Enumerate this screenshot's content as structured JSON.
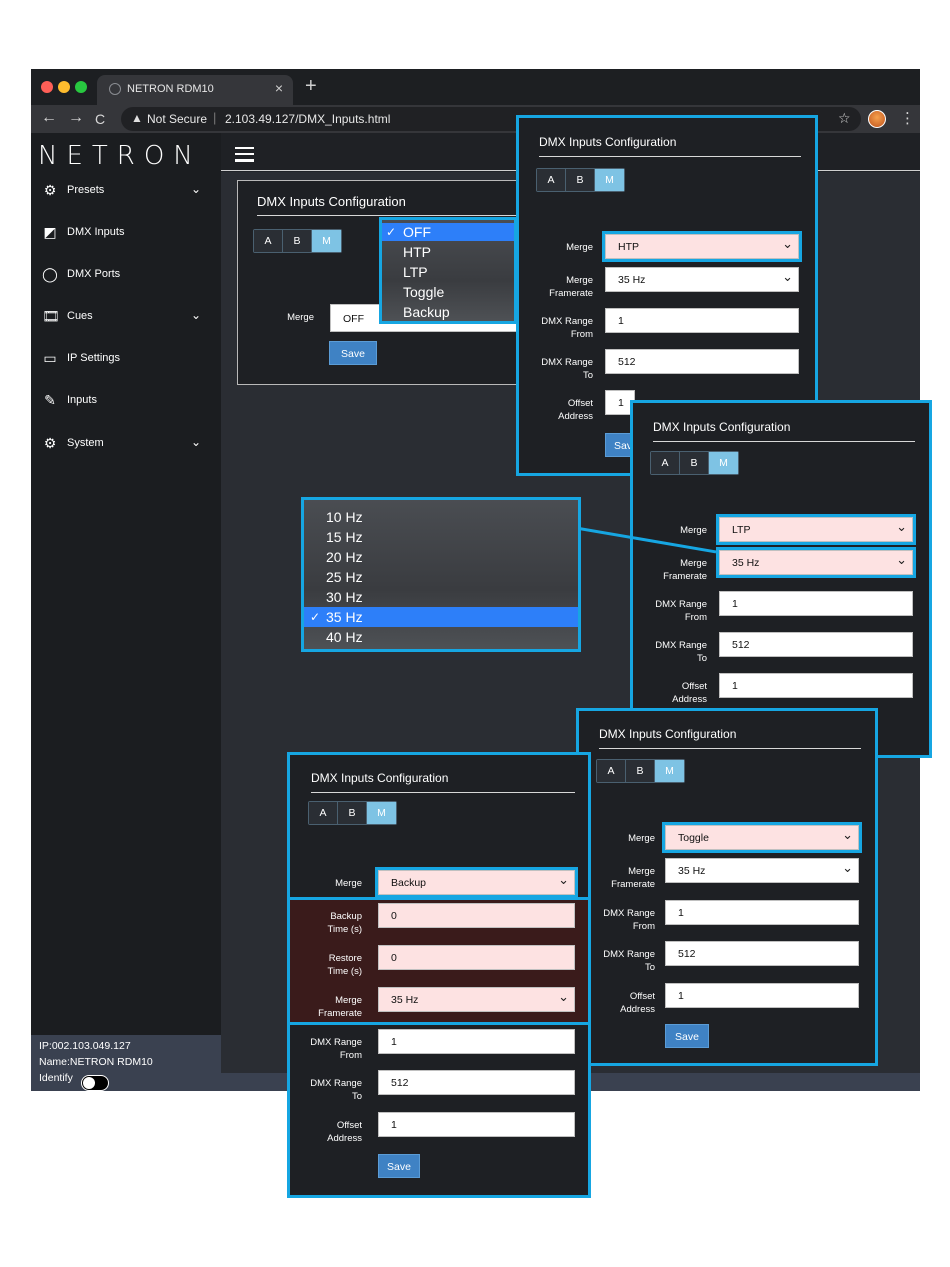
{
  "browser": {
    "tab_title": "NETRON RDM10",
    "tab_close": "×",
    "new_tab": "+",
    "back": "←",
    "forward": "→",
    "reload": "C",
    "security_icon": "▲",
    "security_label": "Not Secure",
    "separator": "|",
    "url": "2.103.49.127/DMX_Inputs.html",
    "star": "☆",
    "menu": "⋮",
    "traffic_colors": [
      "#ff5f57",
      "#febc2e",
      "#28c840"
    ]
  },
  "sidebar": {
    "logo": "NETRON",
    "items": [
      {
        "label": "Presets",
        "icon": "⚙",
        "chev": "⌄"
      },
      {
        "label": "DMX Inputs",
        "icon": "◩",
        "chev": ""
      },
      {
        "label": "DMX Ports",
        "icon": "◯",
        "chev": ""
      },
      {
        "label": "Cues",
        "icon": "🎞",
        "chev": "⌄"
      },
      {
        "label": "IP Settings",
        "icon": "▭",
        "chev": ""
      },
      {
        "label": "Inputs",
        "icon": "✎",
        "chev": ""
      },
      {
        "label": "System",
        "icon": "⚙",
        "chev": "⌄"
      }
    ],
    "footer": {
      "ip": "IP:002.103.049.127",
      "name": "Name:NETRON RDM10",
      "identify": "Identify"
    }
  },
  "config": {
    "title": "DMX Inputs Configuration",
    "tabs": [
      "A",
      "B",
      "M"
    ],
    "labels": {
      "merge": "Merge",
      "framerate": "Merge\nFramerate",
      "range_from": "DMX Range\nFrom",
      "range_to": "DMX Range\nTo",
      "offset": "Offset\nAddress",
      "backup_time": "Backup\nTime (s)",
      "restore_time": "Restore\nTime (s)"
    },
    "save": "Save",
    "values": {
      "merge_off": "OFF",
      "merge_htp": "HTP",
      "merge_ltp": "LTP",
      "merge_toggle": "Toggle",
      "merge_backup": "Backup",
      "framerate": "35 Hz",
      "range_from": "1",
      "range_to": "512",
      "offset": "1",
      "backup_time": "0",
      "restore_time": "0",
      "save_cut": "Sav"
    }
  },
  "merge_menu": [
    {
      "label": "OFF",
      "checked": true
    },
    {
      "label": "HTP",
      "checked": false
    },
    {
      "label": "LTP",
      "checked": false
    },
    {
      "label": "Toggle",
      "checked": false
    },
    {
      "label": "Backup",
      "checked": false
    }
  ],
  "framerate_menu": [
    {
      "label": "10 Hz",
      "checked": false
    },
    {
      "label": "15 Hz",
      "checked": false
    },
    {
      "label": "20 Hz",
      "checked": false
    },
    {
      "label": "25 Hz",
      "checked": false
    },
    {
      "label": "30 Hz",
      "checked": false
    },
    {
      "label": "35 Hz",
      "checked": true
    },
    {
      "label": "40 Hz",
      "checked": false
    }
  ],
  "check_mark": "✓",
  "colors": {
    "accent": "#16a6e2",
    "save": "#3f82c4",
    "highlight_field": "#fde2e2",
    "menu_selected": "#2d7ff9"
  }
}
